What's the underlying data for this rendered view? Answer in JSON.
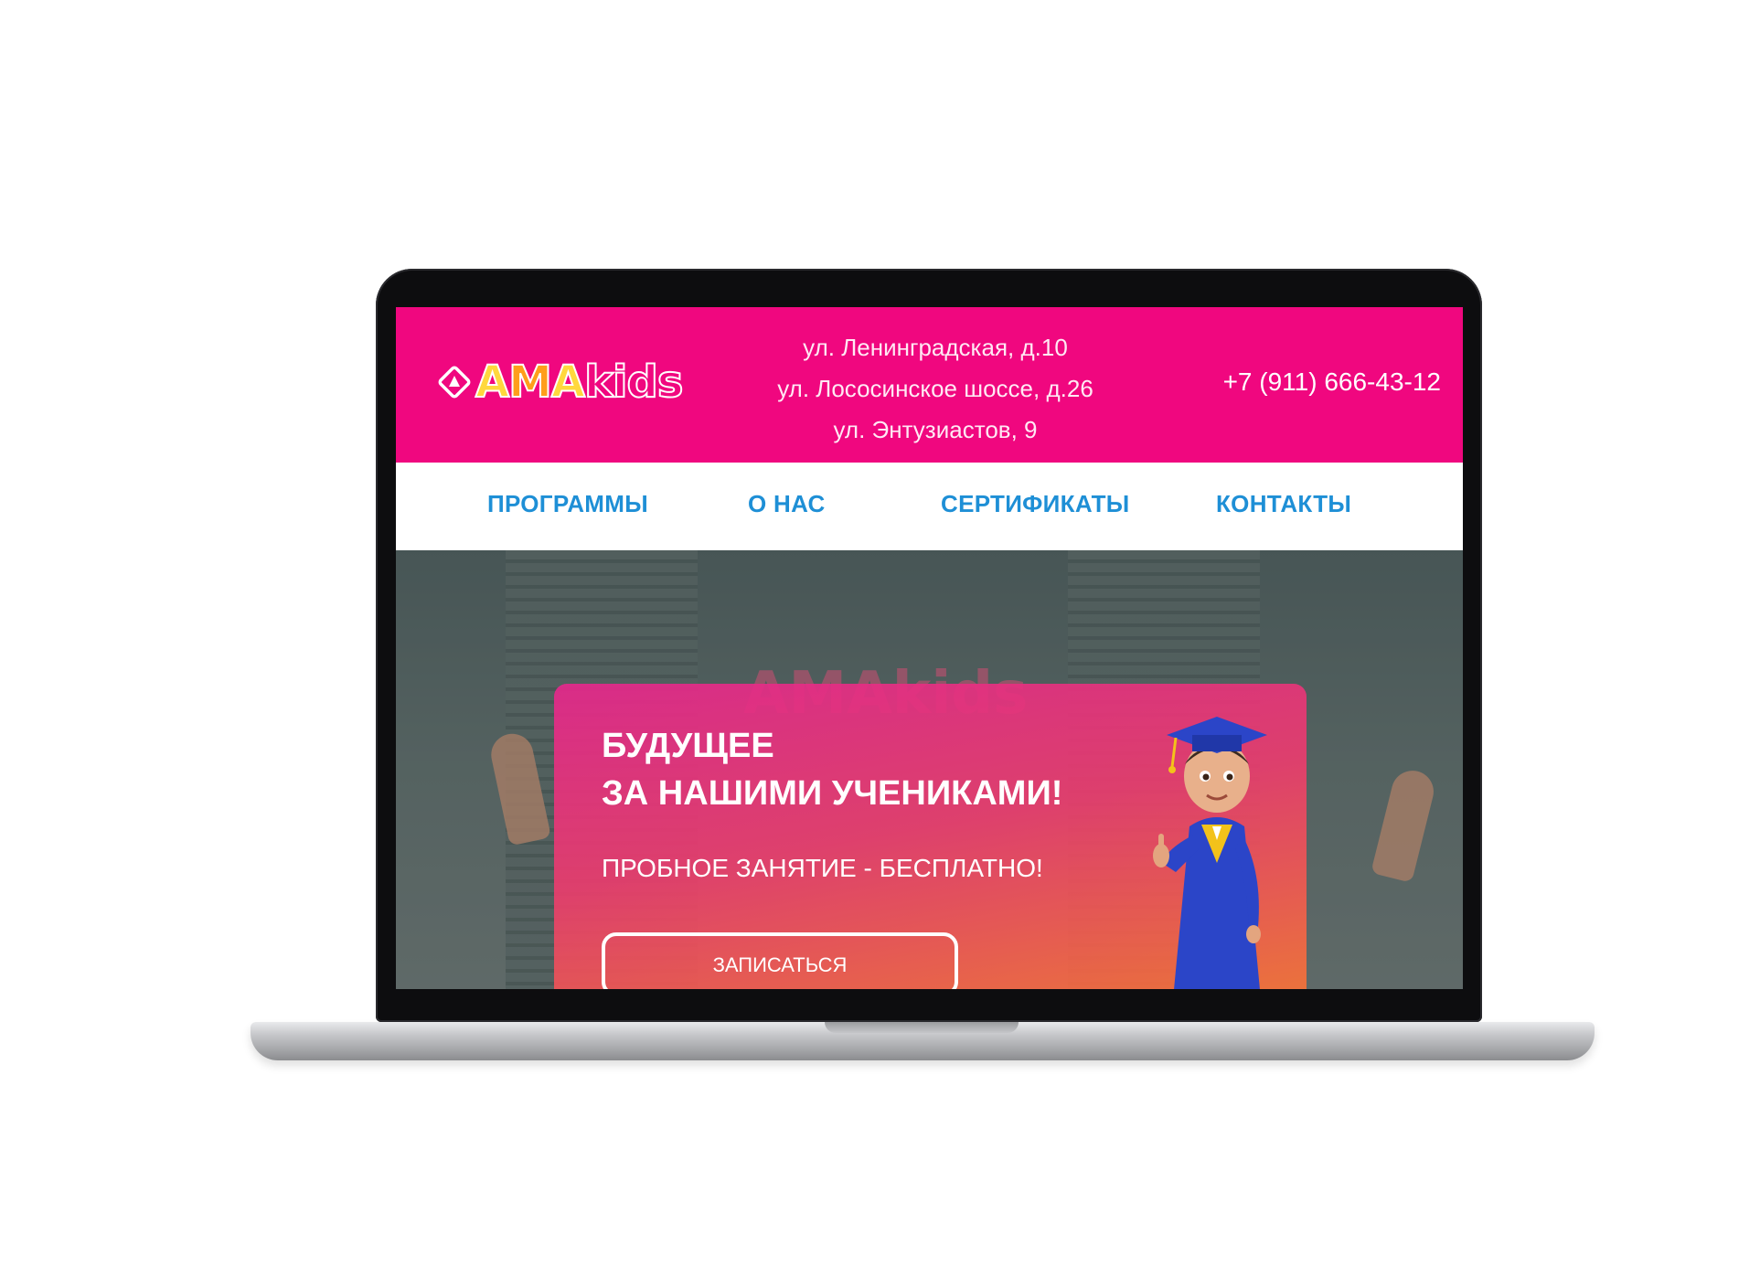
{
  "logo": {
    "brand": "AMAkids",
    "parts": [
      "A",
      "M",
      "A",
      "kids"
    ]
  },
  "header": {
    "addresses": [
      "ул. Ленинградская, д.10",
      "ул. Лососинское шоссе, д.26",
      "ул. Энтузиастов, 9"
    ],
    "phone": "+7 (911) 666-43-12"
  },
  "nav": {
    "items": [
      "ПРОГРАММЫ",
      "О НАС",
      "СЕРТИФИКАТЫ",
      "КОНТАКТЫ"
    ]
  },
  "hero": {
    "headline_line1": "БУДУЩЕЕ",
    "headline_line2": "ЗА НАШИМИ УЧЕНИКАМИ!",
    "subline": "ПРОБНОЕ ЗАНЯТИЕ - БЕСПЛАТНО!",
    "cta_label": "ЗАПИСАТЬСЯ",
    "background_sign": "AMAkids"
  },
  "colors": {
    "brand_pink": "#f0077f",
    "nav_blue": "#1e8fd6",
    "card_gradient_start": "#e4288c",
    "card_gradient_end": "#fc7832",
    "logo_yellow": "#ffd83d",
    "logo_orange": "#ff9e1b"
  },
  "icons": {
    "logo_mark": "diamond-a-icon",
    "mascot": "graduate-boy-mascot"
  }
}
